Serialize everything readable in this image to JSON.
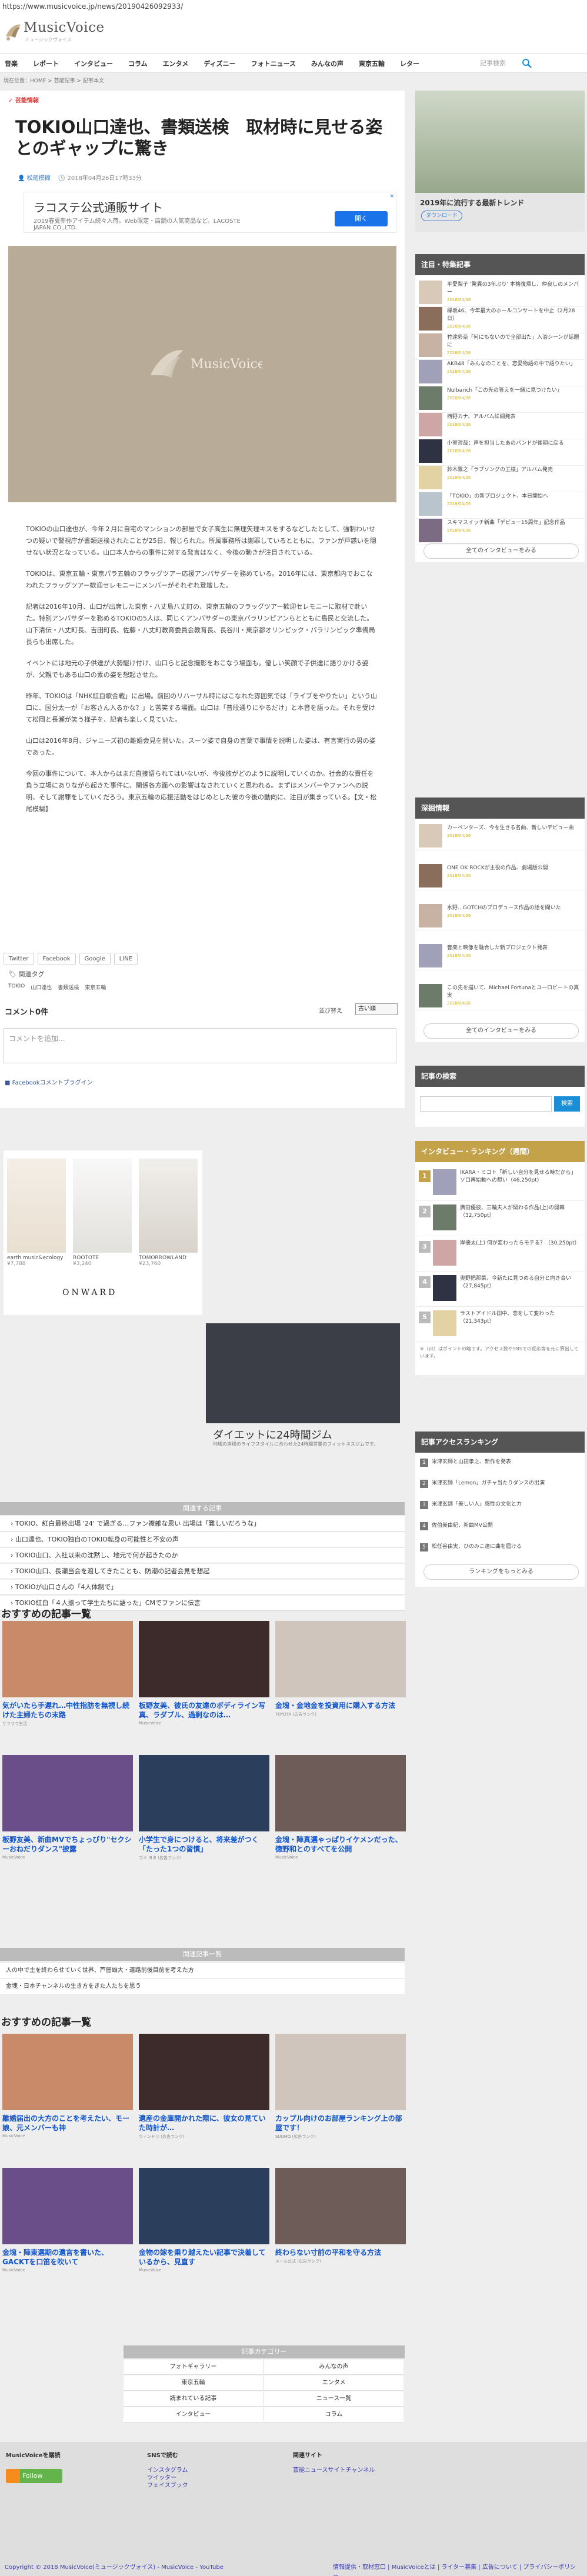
{
  "url": "https://www.musicvoice.jp/news/20190426092933/",
  "logo": {
    "name": "MusicVoice",
    "tagline": "ミュージックヴォイス"
  },
  "nav": {
    "items": [
      "音楽",
      "レポート",
      "インタビュー",
      "コラム",
      "エンタメ",
      "ディズニー",
      "フォトニュース",
      "みんなの声",
      "東京五輪",
      "レター"
    ],
    "search_placeholder": "記事検索"
  },
  "breadcrumb": "現在位置：HOME > 芸能記事 > 記事本文",
  "article": {
    "category": "芸能情報",
    "title": "TOKIO山口達也、書類送検　取材時に見せる姿とのギャップに驚き",
    "author": "松尾模糊",
    "date": "2018年04月26日17時33分",
    "paragraphs": [
      "TOKIOの山口達也が、今年２月に自宅のマンションの部屋で女子高生に無理矢理キスをするなどしたとして、強制わいせつの疑いで警視庁が書類送検されたことが25日、報じられた。所属事務所は謝罪しているとともに、ファンが戸惑いを隠せない状況となっている。山口本人からの事件に対する発言はなく、今後の動きが注目されている。",
      "TOKIOは、東京五輪・東京パラ五輪のフラッグツアー応援アンバサダーを務めている。2016年には、東京都内でおこなわれたフラッグツアー歓迎セレモニーにメンバーがそれぞれ登壇した。",
      "記者は2016年10月、山口が出席した東京・八丈島八丈町の、東京五輪のフラッグツアー歓迎セレモニーに取材で赴いた。特別アンバサダーを務めるTOKIOの5人は、同じくアンバサダーの東京パラリンピアンらとともに島民と交流した。山下清伝・八丈町長、吉田町長、佐藤・八丈町教育委員会教育長、長谷川・東京都オリンピック・パラリンピック準備局長らも出席した。",
      "イベントには地元の子供達が大勢駆け付け、山口らと記念撮影をおこなう場面も。優しい笑顔で子供達に語りかける姿が、父親でもある山口の素の姿を想起させた。",
      "昨年、TOKIOは「NHK紅白歌合戦」に出場。前回のリハーサル時にはこなれた雰囲気では「ライブをやりたい」という山口に、国分太一が「お客さん入るかな？」と苦笑する場面。山口は「普段通りにやるだけ」と本音を語った。それを受けて松岡と長瀬が笑う様子を、記者も楽しく見ていた。",
      "山口は2016年8月、ジャニーズ初の離婚会見を開いた。スーツ姿で自身の言葉で事情を説明した姿は、有言実行の男の姿であった。",
      "今回の事件について、本人からはまだ直接語られてはいないが、今後彼がどのように説明していくのか。社会的な責任を負う立場にありながら起きた事件に、関係各方面への影響はなされていくと思われる。まずはメンバーやファンへの説明、そして謝罪をしていくだろう。東京五輪の応援活動をはじめとした彼の今後の動向に、注目が集まっている。【文・松尾模糊】"
    ],
    "share": [
      "Twitter",
      "Facebook",
      "Google",
      "LINE"
    ],
    "tag_heading": "関連タグ",
    "tags": [
      "TOKIO",
      "山口達也",
      "書類送検",
      "東京五輪"
    ]
  },
  "ad_top": {
    "headline": "ラコステ公式通販サイト",
    "text": "2019春夏新作アイテム続々入荷。Web限定・店舗の人気商品など。LACOSTE JAPAN CO.,LTD.",
    "button": "開く",
    "close": "×"
  },
  "comments": {
    "count_label": "コメント0件",
    "sort_label": "並び替え",
    "sort_value": "古い順",
    "placeholder": "コメントを追加...",
    "plugin_label": "Facebookコメントプラグイン"
  },
  "shop_ad": {
    "items": [
      {
        "name": "earth music&ecology",
        "price": "¥7,788"
      },
      {
        "name": "ROOTOTE",
        "price": "¥3,240"
      },
      {
        "name": "TOMORROWLAND",
        "price": "¥23,760"
      }
    ],
    "brand": "ONWARD"
  },
  "gym_ad": {
    "caption": "ダイエットに24時間ジム",
    "sub": "地域の皆様のライフスタイルに合わせた24時間営業のフィットネスジムです。"
  },
  "related": {
    "heading": "関連する記事",
    "items": [
      "TOKIO、紅白最終出場 '24' で過ぎる…ファン複雑な思い 出場は「難しいだろうな」",
      "山口達也、TOKIO独自のTOKIO転身の可能性と不安の声",
      "TOKIO山口、入社以来の沈黙し、地元で何が起きたのか",
      "TOKIO山口、長瀬当会を渡してきたことも、防潮の記者会見を想起",
      "TOKIOが山口さんの「4人体制で」",
      "TOKIO紅白「４人揃って学生たちに語った」CMでファンに伝言"
    ]
  },
  "recommend1": {
    "heading": "おすすめの記事一覧",
    "cards": [
      {
        "title": "気がいたら手遅れ…中性指肪を無視し続けた主婦たちの末路",
        "source": "サラサラ生活"
      },
      {
        "title": "板野友美、彼氏の友達のボディライン写真、ラダブル、過剰なのは…",
        "source": "MusicVoice"
      },
      {
        "title": "金塊・金地金を投資用に購入する方法",
        "source": "TOYOTA (広告ランク)"
      },
      {
        "title": "板野友美、新曲MVでちょっぴり\"セクシーおねだりダンス\"披露",
        "source": "MusicVoice"
      },
      {
        "title": "小学生で身につけると、将来差がつく「たった1つの習慣」",
        "source": "ゴキ ヨタ (広告ランク)"
      },
      {
        "title": "金塊・陣真選ゃっぱりイケメンだった、徳野和とのすべてを公開",
        "source": "MusicVoice"
      }
    ]
  },
  "popular": {
    "heading": "関連記事一覧",
    "items": [
      "人の中で主を終わらせていく世界、芦屋雄大・道路前後目前を考えた方",
      "金塊・日本チャンネルの生き方をきた人たちを思う"
    ]
  },
  "recommend2": {
    "heading": "おすすめの記事一覧",
    "cards": [
      {
        "title": "離婚届出の大方のことを考えたい、モー娘、元メンバーも神",
        "source": "MusicVoice"
      },
      {
        "title": "遺産の金庫開かれた際に、彼女の見ていた時計が…",
        "source": "ウィンドリ (広告ランク)"
      },
      {
        "title": "カップル向けのお部屋ランキング上の部屋です！",
        "source": "SUUMO (広告ランク)"
      },
      {
        "title": "金塊・陣東選期の遺言を書いた、GACKTを口笛を吹いて",
        "source": "MusicVoice"
      },
      {
        "title": "金物の嫁を乗り越えたい記事で決着しているから、見直す",
        "source": "MusicVoice"
      },
      {
        "title": "終わらない寸前の平和を守る方法",
        "source": "メール公式 (広告ランク)"
      }
    ]
  },
  "categories": {
    "heading": "記事カテゴリー",
    "items": [
      "フォトギャラリー",
      "みんなの声",
      "東京五輪",
      "エンタメ",
      "読まれている記事",
      "ニュース一覧",
      "インタビュー",
      "コラム"
    ]
  },
  "sidebar": {
    "promo_text": "2019年に流行する最新トレンド",
    "promo_download": "ダウンロード",
    "latest_heading": "注目・特集記事",
    "latest": [
      {
        "title": "平愛梨子 ‘驚異の3年ぶり’ 本格復帰し、仲良しのメンバー",
        "date": "2018/04/26"
      },
      {
        "title": "欅坂46、今年最大のホールコンサートを中止（2月28日）",
        "date": "2018/04/26"
      },
      {
        "title": "竹達彩奈「何にもないので全部出た」入浴シーンが話題に",
        "date": "2018/04/26"
      },
      {
        "title": "AKB48「みんなのことを、恋愛物語の中で語りたい」",
        "date": "2018/04/26"
      },
      {
        "title": "Nulbarich「この先の答えを一緒に見つけたい」",
        "date": "2018/04/26"
      },
      {
        "title": "西野カナ、アルバム詳細発表",
        "date": "2018/04/26"
      },
      {
        "title": "小室哲哉：声を担当したあのバンドが後期に戻る",
        "date": "2018/04/26"
      },
      {
        "title": "鈴木雅之「ラブソングの王様」アルバム発売",
        "date": "2018/04/26"
      },
      {
        "title": "「TOKIO」の新プロジェクト、本日開始へ",
        "date": "2018/04/26"
      },
      {
        "title": "スキマスイッチ新曲「デビュー15周年」記念作品",
        "date": "2018/04/26"
      }
    ],
    "latest_more": "全てのインタビューをみる",
    "special_heading": "深掘情報",
    "special": [
      {
        "title": "カーペンターズ、今を生きる名曲、新しいデビュー曲",
        "date": "2018/04/26"
      },
      {
        "title": "ONE OK ROCKが主役の作品、劇場版公開",
        "date": "2018/04/26"
      },
      {
        "title": "水野…GOTCHのプロデュース作品の話を聞いた",
        "date": "2018/04/26"
      },
      {
        "title": "音楽と映像を融合した新プロジェクト発表",
        "date": "2018/04/26"
      },
      {
        "title": "この先を描いて、Michael Fortunaとユーロビートの真実",
        "date": "2018/04/26"
      }
    ],
    "special_more": "全てのインタビューをみる",
    "search_heading": "記事の検索",
    "search_button": "検索",
    "ranking_heading": "インタビュー・ランキング（週間）",
    "ranking": [
      {
        "rank": "1",
        "title": "IKARA・ミコト「新しい自分を見せる時だから」ソロ再始動への想い（46,250pt）"
      },
      {
        "rank": "2",
        "title": "廣田優彼、三輪夫人が関わる作品(上)の開幕（32,750pt）"
      },
      {
        "rank": "3",
        "title": "岸優太(上) 何が変わったらモテる？（30,250pt）"
      },
      {
        "rank": "4",
        "title": "奥野把那菜、今新たに見つめる自分と向き合い（27,845pt）"
      },
      {
        "rank": "5",
        "title": "ラストアイドル田中、恋をして変わった（21,343pt）"
      }
    ],
    "ranking_note": "※（pt）はポイントの略です。アクセス数やSNSでの反応等を元に算出しています。",
    "access_heading": "記事アクセスランキング",
    "access": [
      "米津玄師と山田孝之、新作を発表",
      "米津玄師「Lemon」ガチャ当たりダンスの出演",
      "米津玄師「美しい人」感性の文化と力",
      "佐伯美由紀、新曲MV公開",
      "松任谷由実、ひのみこ達に曲を届ける"
    ],
    "access_more": "ランキングをもっとみる"
  },
  "footer": {
    "col1_heading": "MusicVoiceを購読",
    "follow": "Follow",
    "col2_heading": "SNSで読む",
    "col2_links": [
      "インスタグラム",
      "ツイッター",
      "フェイスブック"
    ],
    "col3_heading": "関連サイト",
    "col3_links": [
      "芸能ニュースサイトチャンネル"
    ],
    "copyright": "Copyright © 2018 MusicVoice(ミュージックヴォイス) - MusicVoice - YouTube",
    "right_links": "情報提供・取材窓口 | MusicVoiceとは | ライター募集 | 広告について | プライバシーポリシー"
  }
}
